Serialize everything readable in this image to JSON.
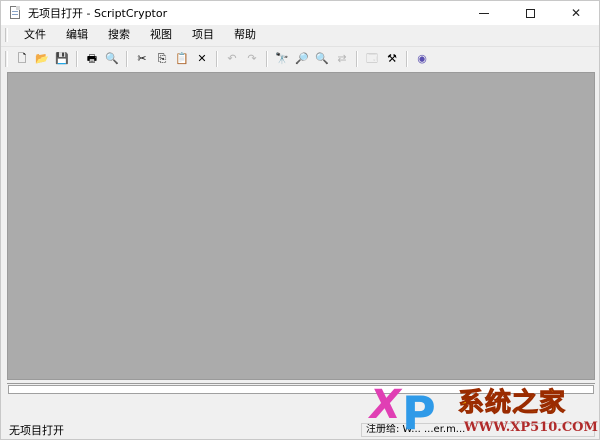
{
  "window": {
    "title": "无项目打开 - ScriptCryptor"
  },
  "menu": {
    "items": [
      "文件",
      "编辑",
      "搜索",
      "视图",
      "项目",
      "帮助"
    ]
  },
  "toolbar": {
    "buttons": [
      {
        "icon": "new-file-icon",
        "glyph": "🗋"
      },
      {
        "icon": "open-folder-icon",
        "glyph": "📂"
      },
      {
        "icon": "save-icon",
        "glyph": "💾"
      },
      {
        "icon": "print-icon",
        "glyph": "🖶"
      },
      {
        "icon": "print-preview-icon",
        "glyph": "🔍"
      },
      {
        "icon": "cut-icon",
        "glyph": "✂"
      },
      {
        "icon": "copy-icon",
        "glyph": "⎘"
      },
      {
        "icon": "paste-icon",
        "glyph": "📋"
      },
      {
        "icon": "delete-icon",
        "glyph": "✕"
      },
      {
        "icon": "undo-icon",
        "glyph": "↶"
      },
      {
        "icon": "redo-icon",
        "glyph": "↷"
      },
      {
        "icon": "find-icon",
        "glyph": "🔭"
      },
      {
        "icon": "find-next-icon",
        "glyph": "🔎"
      },
      {
        "icon": "find-prev-icon",
        "glyph": "🔍"
      },
      {
        "icon": "replace-icon",
        "glyph": "⇄"
      },
      {
        "icon": "project-settings-icon",
        "glyph": "🗔"
      },
      {
        "icon": "build-icon",
        "glyph": "⚒"
      },
      {
        "icon": "help-globe-icon",
        "glyph": "◉"
      }
    ]
  },
  "status": {
    "left": "无项目打开",
    "right": "注册给: W... ...er.m..."
  },
  "watermark": {
    "x": "X",
    "p": "P",
    "text": "系统之家",
    "url": "WWW.XP510.COM"
  },
  "colors": {
    "workspace": "#ababab",
    "chrome": "#f0f0f0",
    "watermark_pink": "#e03fb4",
    "watermark_blue": "#2f9ae8",
    "watermark_gold": "#f6b400"
  }
}
